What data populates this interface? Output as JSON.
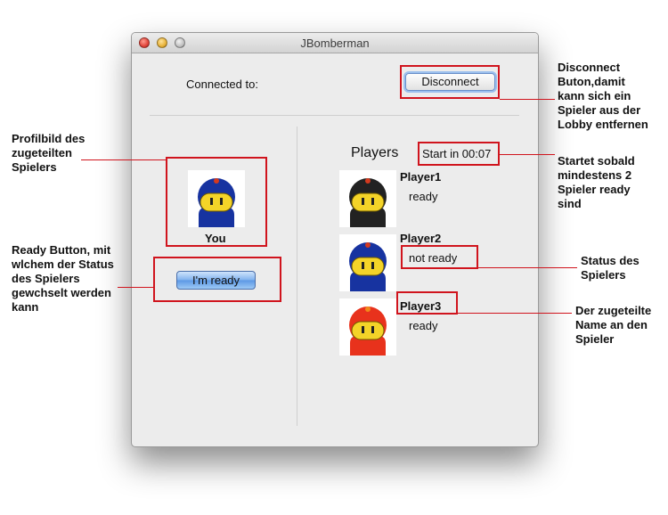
{
  "window": {
    "title": "JBomberman",
    "connected_label": "Connected to:",
    "disconnect_label": "Disconnect",
    "own_player": {
      "name": "You",
      "color": "#1733a0"
    },
    "ready_button_label": "I'm ready",
    "players_heading": "Players",
    "countdown": "Start in 00:07",
    "players": [
      {
        "name": "Player1",
        "status": "ready",
        "color": "#222222"
      },
      {
        "name": "Player2",
        "status": "not ready",
        "color": "#1733a0"
      },
      {
        "name": "Player3",
        "status": "ready",
        "color": "#e8321c"
      }
    ]
  },
  "annotations": {
    "profile_picture": [
      "Profilbild des",
      "zugeteilten",
      "Spielers"
    ],
    "ready_button": [
      "Ready Button, mit",
      "wlchem der Status",
      "des Spielers",
      "gewchselt werden",
      "kann"
    ],
    "disconnect": [
      "Disconnect",
      "Buton,damit",
      "kann sich ein",
      "Spieler aus der",
      "Lobby entfernen"
    ],
    "start_countdown": [
      "Startet sobald",
      "mindestens 2",
      "Spieler ready",
      "sind"
    ],
    "player_status": [
      "Status des",
      "Spielers"
    ],
    "player_name": [
      "Der zugeteilte",
      "Name an den",
      "Spieler"
    ]
  },
  "colors": {
    "annotation_red": "#d0141d",
    "window_bg": "#ececec"
  }
}
